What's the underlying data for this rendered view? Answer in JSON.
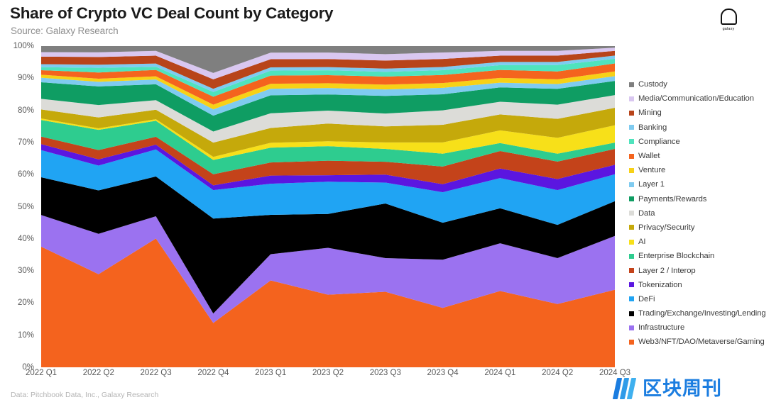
{
  "header": {
    "title": "Share of Crypto VC Deal Count by Category",
    "subtitle": "Source: Galaxy Research"
  },
  "logo": {
    "wordmark": "galaxy",
    "icon": "galaxy-logo-icon"
  },
  "footnote": "Data: Pitchbook Data, Inc., Galaxy Research",
  "watermark": {
    "text": "区块周刊",
    "color": "#1b7de0"
  },
  "chart_data": {
    "type": "area",
    "title": "Share of Crypto VC Deal Count by Category",
    "subtitle": "Source: Galaxy Research",
    "xlabel": "",
    "ylabel": "",
    "ylim": [
      0,
      100
    ],
    "yticks": [
      "0%",
      "10%",
      "20%",
      "30%",
      "40%",
      "50%",
      "60%",
      "70%",
      "80%",
      "90%",
      "100%"
    ],
    "ytick_values": [
      0,
      10,
      20,
      30,
      40,
      50,
      60,
      70,
      80,
      90,
      100
    ],
    "grid": false,
    "stacked": true,
    "normalized_percent": true,
    "legend_position": "right",
    "categories": [
      "2022 Q1",
      "2022 Q2",
      "2022 Q3",
      "2022 Q4",
      "2023 Q1",
      "2023 Q2",
      "2023 Q3",
      "2023 Q4",
      "2024 Q1",
      "2024 Q2",
      "2024 Q3"
    ],
    "series": [
      {
        "name": "Web3/NFT/DAO/Metaverse/Gaming",
        "color": "#f4631e",
        "values": [
          40.0,
          30.0,
          40.5,
          14.0,
          26.5,
          22.5,
          23.5,
          18.5,
          24.0,
          20.0,
          24.5
        ]
      },
      {
        "name": "Infrastructure",
        "color": "#9b72f0",
        "values": [
          10.5,
          13.0,
          7.0,
          3.0,
          8.0,
          14.5,
          10.5,
          15.0,
          15.0,
          14.5,
          17.0
        ]
      },
      {
        "name": "Trading/Exchange/Investing/Lending",
        "color": "#000000",
        "values": [
          12.5,
          14.0,
          12.5,
          30.0,
          12.0,
          10.5,
          17.0,
          11.5,
          11.0,
          10.5,
          11.0
        ]
      },
      {
        "name": "DeFi",
        "color": "#20a4f3",
        "values": [
          9.0,
          8.0,
          8.5,
          9.0,
          9.5,
          10.0,
          6.5,
          9.5,
          9.5,
          11.0,
          8.5
        ]
      },
      {
        "name": "Tokenization",
        "color": "#5b16e0",
        "values": [
          2.0,
          2.0,
          1.5,
          1.5,
          2.5,
          2.0,
          2.5,
          2.5,
          3.0,
          3.5,
          3.0
        ]
      },
      {
        "name": "Layer 2 / Interop",
        "color": "#c4431a",
        "values": [
          2.5,
          3.0,
          2.5,
          3.5,
          4.0,
          4.5,
          4.0,
          5.5,
          5.5,
          5.5,
          5.0
        ]
      },
      {
        "name": "Enterprise Blockchain",
        "color": "#2ecc8f",
        "values": [
          5.5,
          6.5,
          5.0,
          4.5,
          4.5,
          4.5,
          4.0,
          4.0,
          2.5,
          2.5,
          2.0
        ]
      },
      {
        "name": "AI",
        "color": "#f7e019",
        "values": [
          0.5,
          0.5,
          0.5,
          1.0,
          1.5,
          1.5,
          2.0,
          3.5,
          4.0,
          5.0,
          5.5
        ]
      },
      {
        "name": "Privacy/Security",
        "color": "#c5a90b",
        "values": [
          3.0,
          3.5,
          3.0,
          4.5,
          4.5,
          5.5,
          5.0,
          5.5,
          5.0,
          6.0,
          5.5
        ]
      },
      {
        "name": "Data",
        "color": "#dcdcd8",
        "values": [
          3.5,
          4.0,
          3.0,
          3.5,
          4.5,
          4.0,
          4.0,
          4.5,
          4.0,
          4.5,
          4.0
        ]
      },
      {
        "name": "Payments/Rewards",
        "color": "#0f9d63",
        "values": [
          5.5,
          6.0,
          5.0,
          5.0,
          5.5,
          5.0,
          5.5,
          5.0,
          4.5,
          5.0,
          4.5
        ]
      },
      {
        "name": "Layer 1",
        "color": "#7fcbf0",
        "values": [
          1.5,
          1.5,
          1.5,
          2.0,
          2.0,
          2.0,
          2.0,
          2.0,
          1.5,
          1.5,
          1.5
        ]
      },
      {
        "name": "Venture",
        "color": "#f7d117",
        "values": [
          1.0,
          1.0,
          1.0,
          1.5,
          1.5,
          1.5,
          1.5,
          1.5,
          1.5,
          1.5,
          1.5
        ]
      },
      {
        "name": "Wallet",
        "color": "#f4641e",
        "values": [
          1.5,
          2.0,
          2.0,
          2.5,
          2.5,
          2.5,
          2.5,
          2.5,
          2.5,
          2.5,
          2.5
        ]
      },
      {
        "name": "Compliance",
        "color": "#4fe3bd",
        "values": [
          1.0,
          1.5,
          1.0,
          1.5,
          1.5,
          1.5,
          1.5,
          1.5,
          1.5,
          2.0,
          1.5
        ]
      },
      {
        "name": "Banking",
        "color": "#7fcbf0",
        "values": [
          1.0,
          1.0,
          1.0,
          1.0,
          1.0,
          1.0,
          1.0,
          1.0,
          1.0,
          1.0,
          1.0
        ]
      },
      {
        "name": "Mining",
        "color": "#b8441a",
        "values": [
          2.5,
          2.5,
          2.5,
          3.0,
          2.5,
          2.5,
          2.5,
          2.5,
          2.0,
          2.0,
          1.5
        ]
      },
      {
        "name": "Media/Communication/Education",
        "color": "#d9c7f0",
        "values": [
          1.5,
          1.5,
          1.5,
          2.0,
          2.0,
          2.0,
          2.0,
          2.0,
          1.5,
          1.5,
          1.0
        ]
      },
      {
        "name": "Custody",
        "color": "#7f7f7f",
        "values": [
          2.0,
          2.0,
          1.5,
          8.5,
          2.0,
          2.0,
          2.5,
          2.0,
          1.5,
          1.5,
          0.5
        ]
      }
    ]
  },
  "legend": {
    "items": [
      {
        "label": "Custody",
        "color": "#7f7f7f"
      },
      {
        "label": "Media/Communication/Education",
        "color": "#d9c7f0"
      },
      {
        "label": "Mining",
        "color": "#b8441a"
      },
      {
        "label": "Banking",
        "color": "#7fcbf0"
      },
      {
        "label": "Compliance",
        "color": "#4fe3bd"
      },
      {
        "label": "Wallet",
        "color": "#f4641e"
      },
      {
        "label": "Venture",
        "color": "#f7d117"
      },
      {
        "label": "Layer 1",
        "color": "#7fcbf0"
      },
      {
        "label": "Payments/Rewards",
        "color": "#0f9d63"
      },
      {
        "label": "Data",
        "color": "#dcdcd8"
      },
      {
        "label": "Privacy/Security",
        "color": "#c5a90b"
      },
      {
        "label": "AI",
        "color": "#f7e019"
      },
      {
        "label": "Enterprise Blockchain",
        "color": "#2ecc8f"
      },
      {
        "label": "Layer 2 / Interop",
        "color": "#c4431a"
      },
      {
        "label": "Tokenization",
        "color": "#5b16e0"
      },
      {
        "label": "DeFi",
        "color": "#20a4f3"
      },
      {
        "label": "Trading/Exchange/Investing/Lending",
        "color": "#000000"
      },
      {
        "label": "Infrastructure",
        "color": "#9b72f0"
      },
      {
        "label": "Web3/NFT/DAO/Metaverse/Gaming",
        "color": "#f4631e"
      }
    ]
  }
}
